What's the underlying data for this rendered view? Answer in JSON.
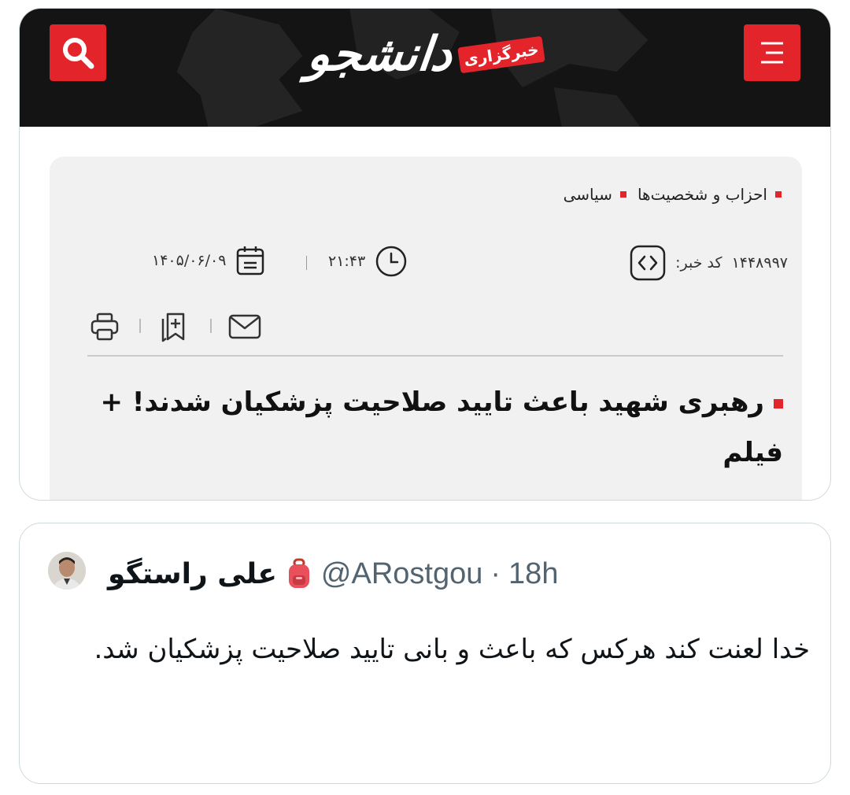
{
  "news_card": {
    "site": {
      "logo_text": "دانشجو",
      "logo_badge": "خبرگزاری",
      "search_icon": "search-icon",
      "menu_icon": "hamburger-menu-icon"
    },
    "breadcrumb": [
      {
        "label": "سیاسی"
      },
      {
        "label": "احزاب و شخصیت‌ها"
      }
    ],
    "meta": {
      "news_code_label": "کد خبر:",
      "news_code": "۱۴۴۸۹۹۷",
      "time": "۲۱:۴۳",
      "date": "۱۴۰۵/۰۶/۰۹"
    },
    "tools": [
      "email-icon",
      "copy-link-icon",
      "print-icon"
    ],
    "headline": "رهبری شهید باعث تایید صلاحیت پزشکیان شدند! + فیلم"
  },
  "tweet": {
    "author_name": "علی راستگو",
    "author_emoji": "backpack-emoji",
    "handle": "@ARostgou",
    "separator": "·",
    "time": "18h",
    "text": "خدا لعنت کند هرکس که باعث و بانی تایید صلاحیت پزشکیان شد."
  },
  "colors": {
    "brand_red": "#e3242b",
    "header_bg": "#141414",
    "article_bg": "#f1f1f1",
    "tweet_border": "#cfd9de",
    "handle_gray": "#536471"
  }
}
